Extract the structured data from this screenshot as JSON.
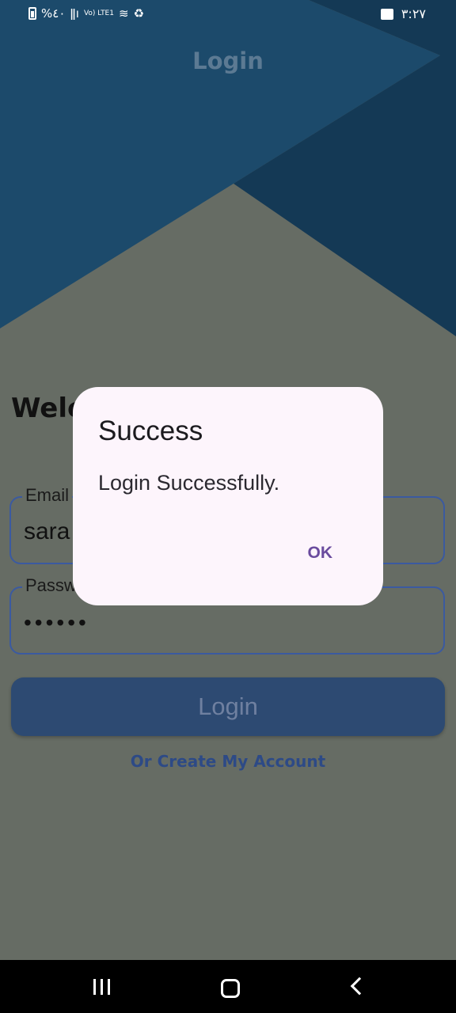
{
  "status_bar": {
    "left_text": "%٤٠",
    "network_text": "Vo) LTE1",
    "time": "٣:٢٧"
  },
  "header": {
    "title": "Login"
  },
  "form": {
    "welcome_text": "Welc",
    "email": {
      "label": "Email",
      "value": "sara"
    },
    "password": {
      "label": "Passw",
      "value": "••••••"
    },
    "login_button": "Login",
    "create_account_link": "Or Create My Account"
  },
  "dialog": {
    "title": "Success",
    "message": "Login Successfully.",
    "ok_label": "OK"
  },
  "nav_bar": {
    "recent_icon": "recent-apps-icon",
    "home_icon": "home-icon",
    "back_icon": "back-icon"
  }
}
